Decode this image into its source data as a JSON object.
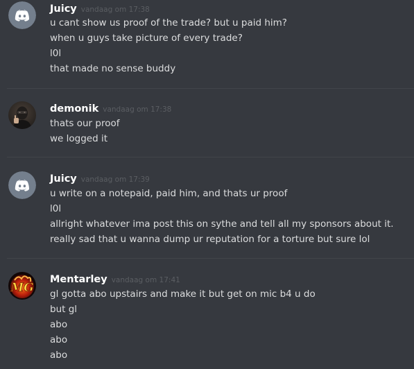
{
  "messages": [
    {
      "author": "Juicy",
      "timestamp": "vandaag om 17:38",
      "avatar_icon": "discord-logo-icon",
      "lines": [
        "u cant show us proof of the trade? but u paid him?",
        "when u guys take picture of every trade?",
        "l0l",
        "that made no sense buddy"
      ]
    },
    {
      "author": "demonik",
      "timestamp": "vandaag om 17:38",
      "avatar_icon": "masked-person-avatar-icon",
      "lines": [
        "thats our proof",
        "we logged it"
      ]
    },
    {
      "author": "Juicy",
      "timestamp": "vandaag om 17:39",
      "avatar_icon": "discord-logo-icon",
      "lines": [
        "u write on a notepaid, paid him, and thats ur proof",
        "l0l",
        "allright whatever ima post this on sythe and tell all my sponsors about it.",
        "really sad that u wanna dump ur reputation for a torture but sure lol"
      ]
    },
    {
      "author": "Mentarley",
      "timestamp": "vandaag om 17:41",
      "avatar_icon": "mg-logo-avatar-icon",
      "lines": [
        "gl gotta abo upstairs and make it but get on mic b4 u do",
        "but gl",
        "abo",
        "abo",
        "abo"
      ]
    }
  ],
  "colors": {
    "background": "#36393f",
    "username": "#ffffff",
    "message_text": "#dcddde",
    "timestamp": "#5b5e63",
    "divider": "#42454a",
    "discord_avatar_bg": "#747f8d"
  }
}
